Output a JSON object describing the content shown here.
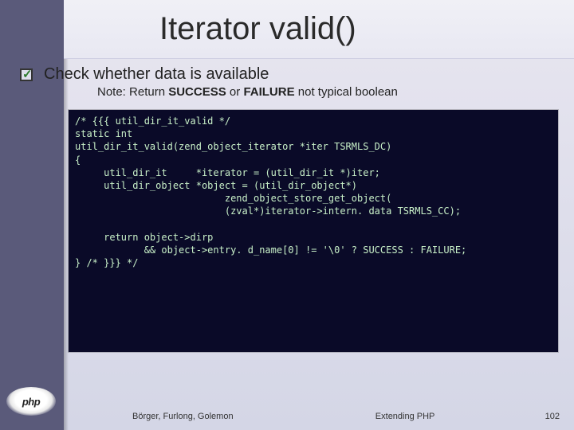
{
  "title": "Iterator valid()",
  "bullet": "Check whether data is available",
  "note_prefix": "Note: Return ",
  "note_k1": "SUCCESS",
  "note_mid": " or ",
  "note_k2": "FAILURE",
  "note_suffix": " not typical boolean",
  "code": "/* {{{ util_dir_it_valid */\nstatic int\nutil_dir_it_valid(zend_object_iterator *iter TSRMLS_DC)\n{\n     util_dir_it     *iterator = (util_dir_it *)iter;\n     util_dir_object *object = (util_dir_object*)\n                          zend_object_store_get_object(\n                          (zval*)iterator->intern. data TSRMLS_CC);\n\n     return object->dirp\n            && object->entry. d_name[0] != '\\0' ? SUCCESS : FAILURE;\n} /* }}} */",
  "footer": {
    "left": "Börger, Furlong, Golemon",
    "center": "Extending PHP",
    "right": "102"
  },
  "logo": "php"
}
